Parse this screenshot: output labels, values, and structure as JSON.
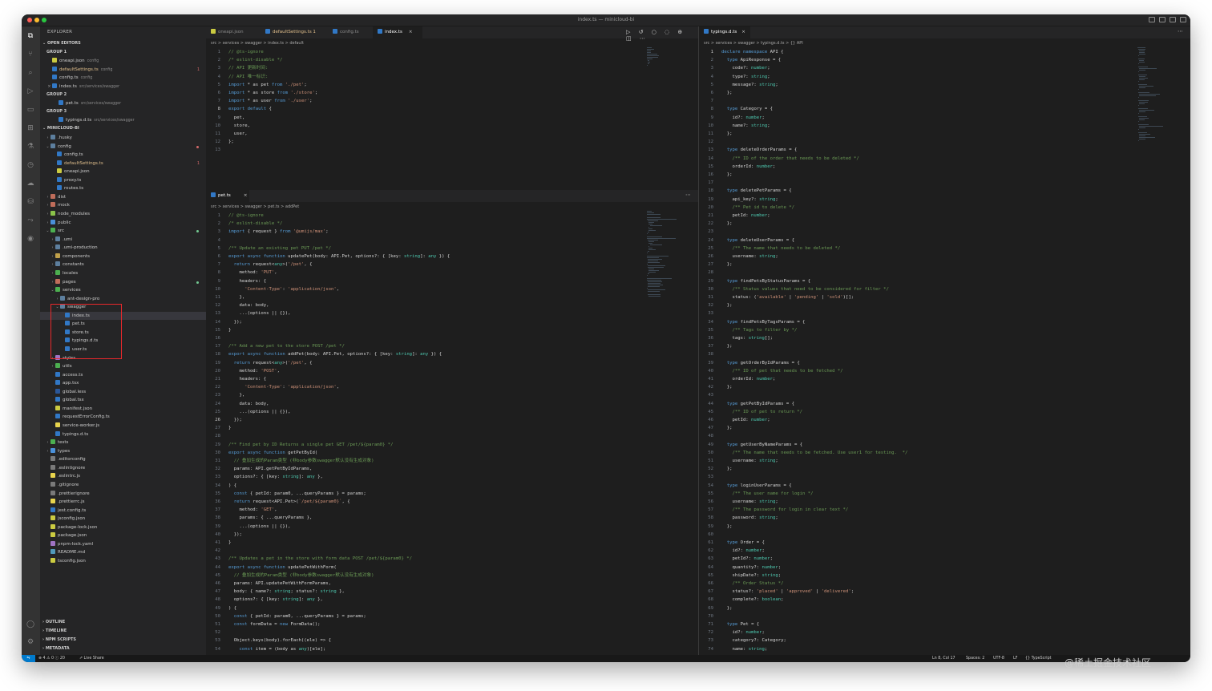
{
  "window": {
    "title": "index.ts — minicloud-bi"
  },
  "sidebar": {
    "header": "EXPLORER",
    "open_editors": "OPEN EDITORS",
    "group1": "GROUP 1",
    "group2": "GROUP 2",
    "group3": "GROUP 3",
    "project": "MINICLOUD-BI",
    "outline": "OUTLINE",
    "timeline": "TIMELINE",
    "npm": "NPM SCRIPTS",
    "metadata": "METADATA"
  },
  "open_editors": [
    {
      "name": "oneapi.json",
      "desc": "config"
    },
    {
      "name": "defaultSettings.ts",
      "desc": "config",
      "badge": "1"
    },
    {
      "name": "config.ts",
      "desc": "config"
    },
    {
      "name": "index.ts",
      "desc": "src/services/swagger"
    },
    {
      "name": "pet.ts",
      "desc": "src/services/swagger"
    },
    {
      "name": "typings.d.ts",
      "desc": "src/services/swagger"
    }
  ],
  "tree": [
    {
      "name": ".husky"
    },
    {
      "name": "config"
    },
    {
      "name": "config.ts"
    },
    {
      "name": "defaultSettings.ts",
      "badge": "1"
    },
    {
      "name": "oneapi.json"
    },
    {
      "name": "proxy.ts"
    },
    {
      "name": "routes.ts"
    },
    {
      "name": "dist"
    },
    {
      "name": "mock"
    },
    {
      "name": "node_modules"
    },
    {
      "name": "public"
    },
    {
      "name": "src"
    },
    {
      "name": ".umi"
    },
    {
      "name": ".umi-production"
    },
    {
      "name": "components"
    },
    {
      "name": "constants"
    },
    {
      "name": "locales"
    },
    {
      "name": "pages"
    },
    {
      "name": "services"
    },
    {
      "name": "ant-design-pro"
    },
    {
      "name": "swagger"
    },
    {
      "name": "index.ts"
    },
    {
      "name": "pet.ts"
    },
    {
      "name": "store.ts"
    },
    {
      "name": "typings.d.ts"
    },
    {
      "name": "user.ts"
    },
    {
      "name": "styles"
    },
    {
      "name": "utils"
    },
    {
      "name": "access.ts"
    },
    {
      "name": "app.tsx"
    },
    {
      "name": "global.less"
    },
    {
      "name": "global.tsx"
    },
    {
      "name": "manifest.json"
    },
    {
      "name": "requestErrorConfig.ts"
    },
    {
      "name": "service-worker.js"
    },
    {
      "name": "typings.d.ts"
    },
    {
      "name": "tests"
    },
    {
      "name": "types"
    },
    {
      "name": ".editorconfig"
    },
    {
      "name": ".eslintignore"
    },
    {
      "name": ".eslintrc.js"
    },
    {
      "name": ".gitignore"
    },
    {
      "name": ".prettierignore"
    },
    {
      "name": ".prettierrc.js"
    },
    {
      "name": "jest.config.ts"
    },
    {
      "name": "jsconfig.json"
    },
    {
      "name": "package-lock.json"
    },
    {
      "name": "package.json"
    },
    {
      "name": "pnpm-lock.yaml"
    },
    {
      "name": "README.md"
    },
    {
      "name": "tsconfig.json"
    }
  ],
  "tabs_top": [
    {
      "label": "oneapi.json"
    },
    {
      "label": "defaultSettings.ts 1"
    },
    {
      "label": "config.ts"
    },
    {
      "label": "index.ts"
    }
  ],
  "tab_pet": "pet.ts",
  "tab_typings": "typings.d.ts",
  "breadcrumb_index": "src > services > swagger > index.ts > default",
  "breadcrumb_pet": "src > services > swagger > pet.ts > addPet",
  "breadcrumb_typings": "src > services > swagger > typings.d.ts > {} API",
  "code_index": [
    "// @ts-ignore",
    "/* eslint-disable */",
    "// API 更新时间:",
    "// API 唯一标识:",
    "import * as pet from './pet';",
    "import * as store from './store';",
    "import * as user from './user';",
    "export default {",
    "  pet,",
    "  store,",
    "  user,",
    "};",
    ""
  ],
  "code_pet": [
    "// @ts-ignore",
    "/* eslint-disable */",
    "import { request } from '@umijs/max';",
    "",
    "/** Update an existing pet PUT /pet */",
    "export async function updatePet(body: API.Pet, options?: { [key: string]: any }) {",
    "  return request<any>('/pet', {",
    "    method: 'PUT',",
    "    headers: {",
    "      'Content-Type': 'application/json',",
    "    },",
    "    data: body,",
    "    ...(options || {}),",
    "  });",
    "}",
    "",
    "/** Add a new pet to the store POST /pet */",
    "export async function addPet(body: API.Pet, options?: { [key: string]: any }) {",
    "  return request<any>('/pet', {",
    "    method: 'POST',",
    "    headers: {",
    "      'Content-Type': 'application/json',",
    "    },",
    "    data: body,",
    "    ...(options || {}),",
    "  });",
    "}",
    "",
    "/** Find pet by ID Returns a single pet GET /pet/${param0} */",
    "export async function getPetById(",
    "  // 叠加生成的Param类型 (非body参数swagger默认没有生成对象)",
    "  params: API.getPetByIdParams,",
    "  options?: { [key: string]: any },",
    ") {",
    "  const { petId: param0, ...queryParams } = params;",
    "  return request<API.Pet>(`/pet/${param0}`, {",
    "    method: 'GET',",
    "    params: { ...queryParams },",
    "    ...(options || {}),",
    "  });",
    "}",
    "",
    "/** Updates a pet in the store with form data POST /pet/${param0} */",
    "export async function updatePetWithForm(",
    "  // 叠加生成的Param类型 (非body参数swagger默认没有生成对象)",
    "  params: API.updatePetWithFormParams,",
    "  body: { name?: string; status?: string },",
    "  options?: { [key: string]: any },",
    ") {",
    "  const { petId: param0, ...queryParams } = params;",
    "  const formData = new FormData();",
    "",
    "  Object.keys(body).forEach((ele) => {",
    "    const item = (body as any)[ele];"
  ],
  "code_typings": [
    "declare namespace API {",
    "  type ApiResponse = {",
    "    code?: number;",
    "    type?: string;",
    "    message?: string;",
    "  };",
    "",
    "  type Category = {",
    "    id?: number;",
    "    name?: string;",
    "  };",
    "",
    "  type deleteOrderParams = {",
    "    /** ID of the order that needs to be deleted */",
    "    orderId: number;",
    "  };",
    "",
    "  type deletePetParams = {",
    "    api_key?: string;",
    "    /** Pet id to delete */",
    "    petId: number;",
    "  };",
    "",
    "  type deleteUserParams = {",
    "    /** The name that needs to be deleted */",
    "    username: string;",
    "  };",
    "",
    "  type findPetsByStatusParams = {",
    "    /** Status values that need to be considered for filter */",
    "    status: ('available' | 'pending' | 'sold')[];",
    "  };",
    "",
    "  type findPetsByTagsParams = {",
    "    /** Tags to filter by */",
    "    tags: string[];",
    "  };",
    "",
    "  type getOrderByIdParams = {",
    "    /** ID of pet that needs to be fetched */",
    "    orderId: number;",
    "  };",
    "",
    "  type getPetByIdParams = {",
    "    /** ID of pet to return */",
    "    petId: number;",
    "  };",
    "",
    "  type getUserByNameParams = {",
    "    /** The name that needs to be fetched. Use user1 for testing.  */",
    "    username: string;",
    "  };",
    "",
    "  type loginUserParams = {",
    "    /** The user name for login */",
    "    username: string;",
    "    /** The password for login in clear text */",
    "    password: string;",
    "  };",
    "",
    "  type Order = {",
    "    id?: number;",
    "    petId?: number;",
    "    quantity?: number;",
    "    shipDate?: string;",
    "    /** Order Status */",
    "    status?: 'placed' | 'approved' | 'delivered';",
    "    complete?: boolean;",
    "  };",
    "",
    "  type Pet = {",
    "    id?: number;",
    "    category?: Category;",
    "    name: string;"
  ],
  "current_line_index": 8,
  "current_line_pet": 26,
  "current_line_typings": 1,
  "status": {
    "problems": "⊗ 4 ⚠ 0 ⓘ 20",
    "liveshare": "Live Share",
    "position": "Ln 8, Col 17",
    "spaces": "Spaces: 2",
    "encoding": "UTF-8",
    "eol": "LF",
    "language": "{} TypeScript"
  },
  "watermark": "@稀土掘金技术社区",
  "colors": {
    "accent": "#007acc",
    "highlight_box": "#e8282b",
    "editor_bg": "#1e1e1e",
    "sidebar_bg": "#252526"
  }
}
